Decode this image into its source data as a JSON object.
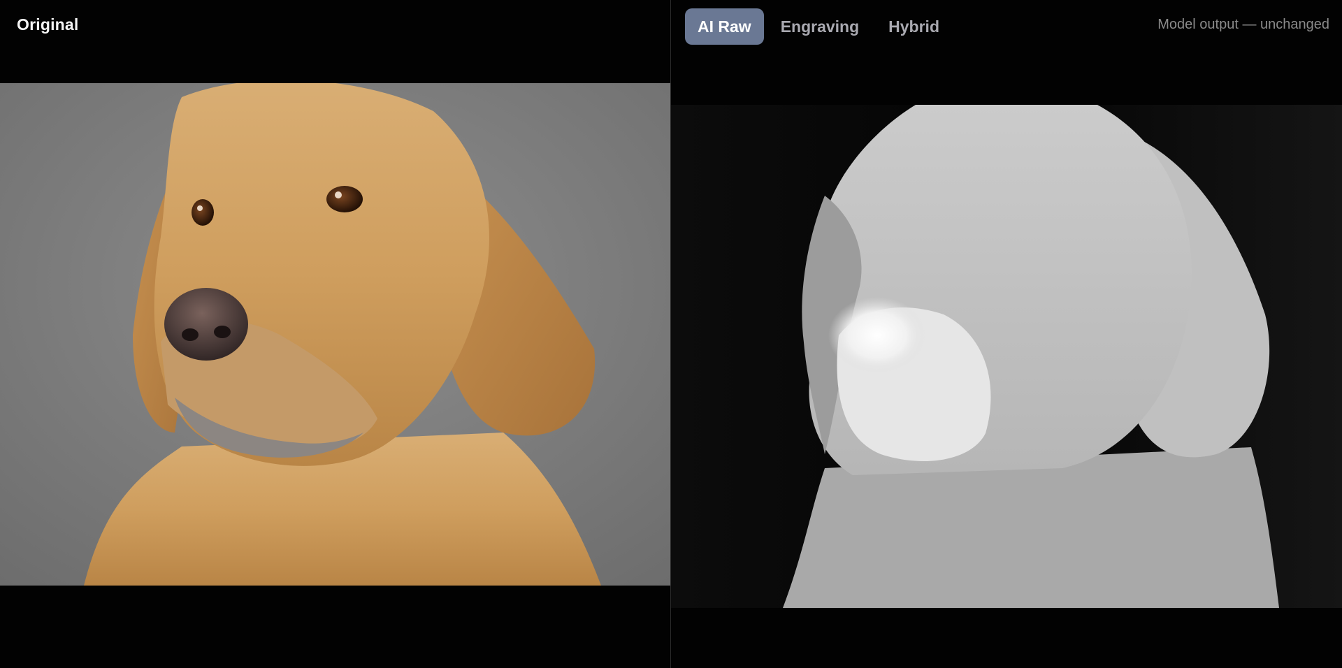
{
  "left_panel": {
    "title": "Original"
  },
  "right_panel": {
    "tabs": [
      {
        "label": "AI Raw",
        "active": true
      },
      {
        "label": "Engraving",
        "active": false
      },
      {
        "label": "Hybrid",
        "active": false
      }
    ],
    "status_text": "Model output — unchanged"
  },
  "colors": {
    "background": "#020202",
    "active_tab": "#6a7894",
    "inactive_tab_text": "#a9a9b0",
    "status_text": "#8a8a8a"
  }
}
